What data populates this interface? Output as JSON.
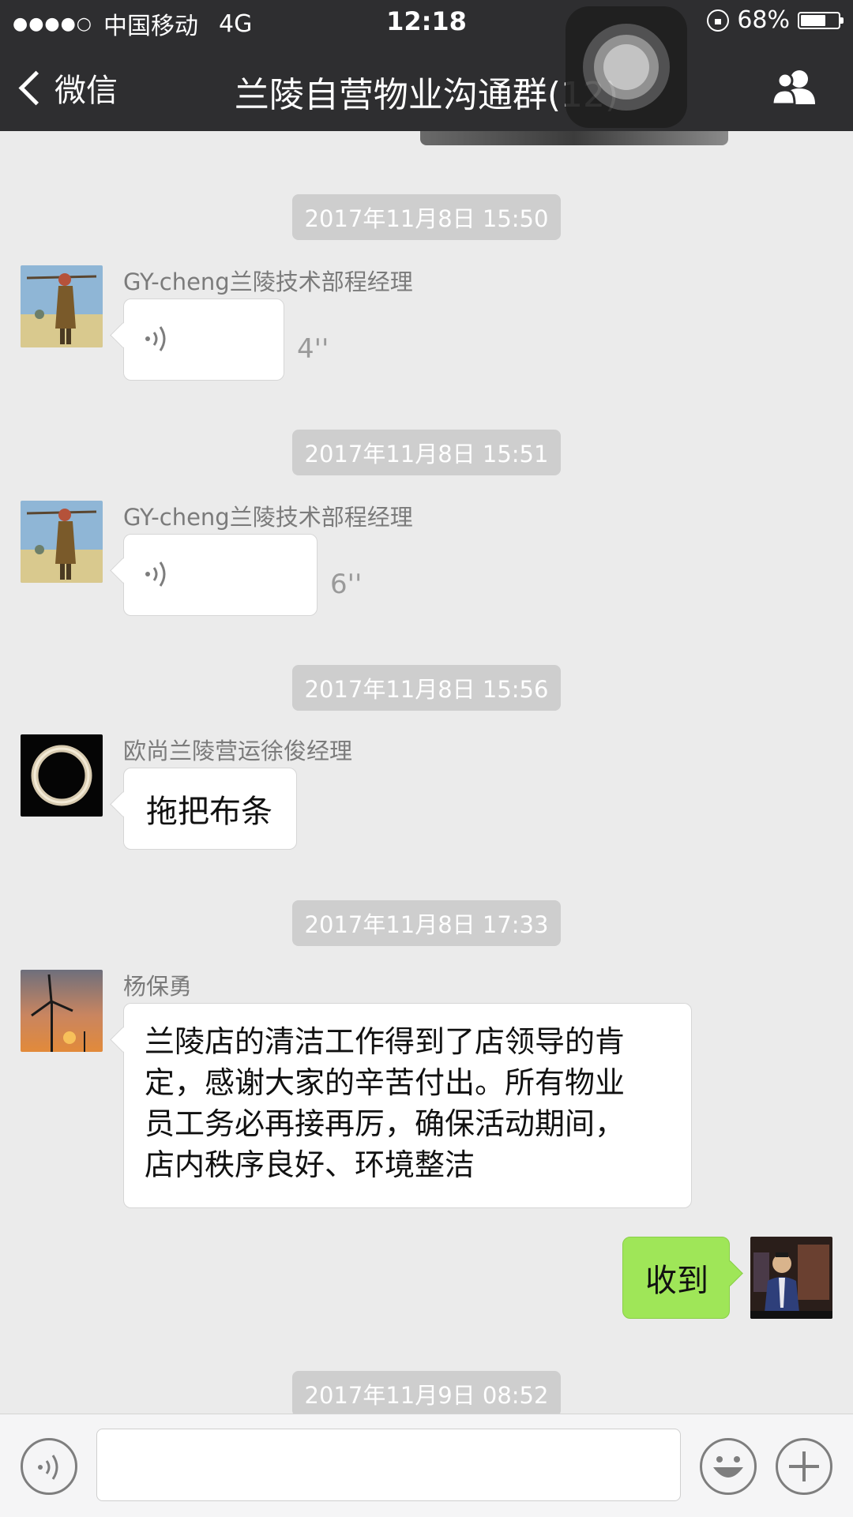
{
  "status_bar": {
    "signal_dots": "●●●●○",
    "carrier": "中国移动",
    "network": "4G",
    "time": "12:18",
    "battery_percent": "68%",
    "battery_level": 0.68
  },
  "nav": {
    "back_label": "微信",
    "title": "兰陵自营物业沟通群(12)"
  },
  "messages": [
    {
      "type": "timestamp",
      "text": "2017年11月8日 15:50"
    },
    {
      "type": "voice",
      "sender": "GY-cheng兰陵技术部程经理",
      "duration": "4''"
    },
    {
      "type": "timestamp",
      "text": "2017年11月8日 15:51"
    },
    {
      "type": "voice",
      "sender": "GY-cheng兰陵技术部程经理",
      "duration": "6''"
    },
    {
      "type": "timestamp",
      "text": "2017年11月8日 15:56"
    },
    {
      "type": "text",
      "sender": "欧尚兰陵营运徐俊经理",
      "text": "拖把布条"
    },
    {
      "type": "timestamp",
      "text": "2017年11月8日 17:33"
    },
    {
      "type": "text",
      "sender": "杨保勇",
      "lines": [
        "兰陵店的清洁工作得到了店领导的肯",
        "定，感谢大家的辛苦付出。所有物业",
        "员工务必再接再厉，确保活动期间，",
        "店内秩序良好、环境整洁"
      ]
    },
    {
      "type": "text",
      "sender": "self",
      "text": "收到"
    },
    {
      "type": "timestamp",
      "text": "2017年11月9日 08:52"
    }
  ],
  "colors": {
    "nav_bg": "#2e2e30",
    "chat_bg": "#ebebeb",
    "self_bubble": "#9fe658",
    "timestamp_bg": "#cecece"
  },
  "icons": {
    "back": "chevron-left-icon",
    "members": "group-members-icon",
    "voice": "voice-wave-icon",
    "emoji": "emoji-icon",
    "plus": "plus-icon"
  }
}
